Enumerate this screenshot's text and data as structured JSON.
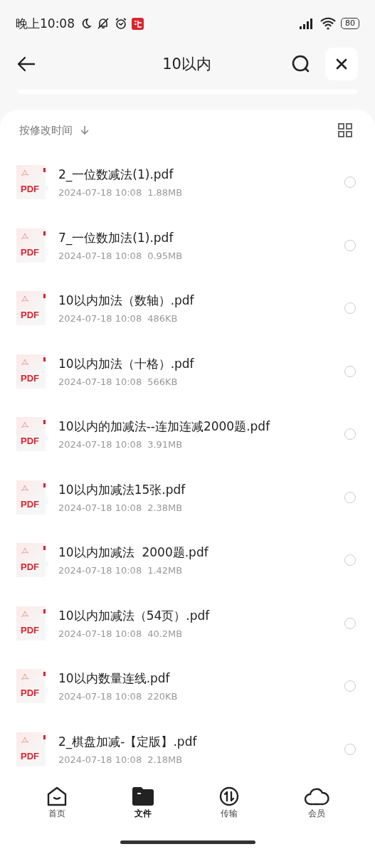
{
  "status_bar": {
    "time": "晚上10:08",
    "battery": "80"
  },
  "header": {
    "title": "10以内"
  },
  "sort": {
    "label": "按修改时间"
  },
  "files": [
    {
      "name": "2_一位数减法(1).pdf",
      "date": "2024-07-18 10:08",
      "size": "1.88MB",
      "selected": false
    },
    {
      "name": "7_一位数加法(1).pdf",
      "date": "2024-07-18 10:08",
      "size": "0.95MB",
      "selected": false
    },
    {
      "name": "10以内加法（数轴）.pdf",
      "date": "2024-07-18 10:08",
      "size": "486KB",
      "selected": false
    },
    {
      "name": "10以内加法（十格）.pdf",
      "date": "2024-07-18 10:08",
      "size": "566KB",
      "selected": false
    },
    {
      "name": "10以内的加减法--连加连减2000题.pdf",
      "date": "2024-07-18 10:08",
      "size": "3.91MB",
      "selected": false
    },
    {
      "name": "10以内加减法15张.pdf",
      "date": "2024-07-18 10:08",
      "size": "2.38MB",
      "selected": false
    },
    {
      "name": "10以内加减法  2000题.pdf",
      "date": "2024-07-18 10:08",
      "size": "1.42MB",
      "selected": false
    },
    {
      "name": "10以内加减法（54页）.pdf",
      "date": "2024-07-18 10:08",
      "size": "40.2MB",
      "selected": false
    },
    {
      "name": "10以内数量连线.pdf",
      "date": "2024-07-18 10:08",
      "size": "220KB",
      "selected": false
    },
    {
      "name": "2_棋盘加减-【定版】.pdf",
      "date": "2024-07-18 10:08",
      "size": "2.18MB",
      "selected": false
    }
  ],
  "file_badges": [
    "PDF",
    "PDF",
    "PDF",
    "PDF",
    "PDF",
    "PDF",
    "PDF",
    "PDF",
    "PDF",
    "PDF"
  ],
  "nav": [
    {
      "label": "首页",
      "selected": false
    },
    {
      "label": "文件",
      "selected": true
    },
    {
      "label": "传输",
      "selected": false
    },
    {
      "label": "会员",
      "selected": false
    }
  ]
}
